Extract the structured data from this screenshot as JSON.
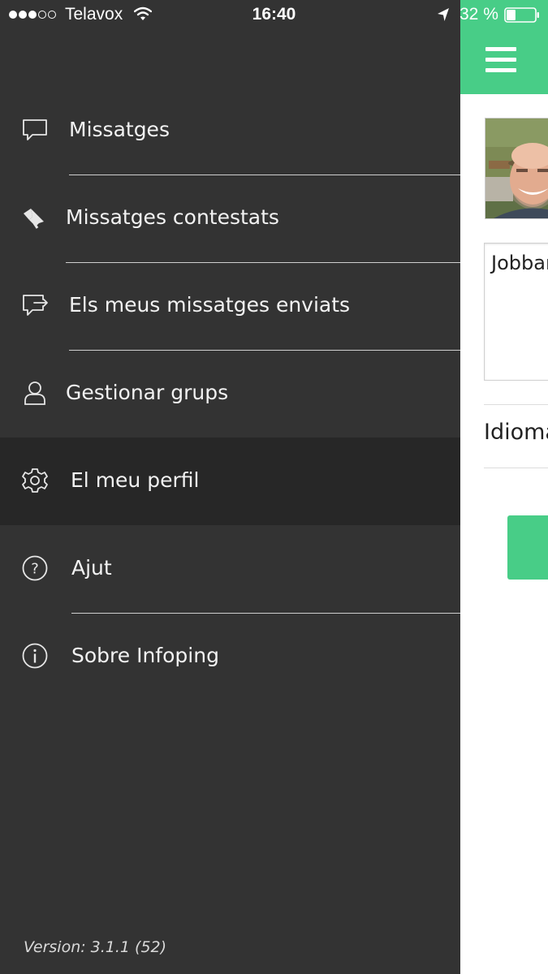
{
  "status_bar": {
    "signal_bars_filled": 3,
    "signal_bars_total": 5,
    "carrier": "Telavox",
    "time": "16:40",
    "battery_percent": "32 %",
    "battery_level": 0.32
  },
  "drawer": {
    "items": [
      {
        "label": "Missatges",
        "icon": "message-icon",
        "active": false
      },
      {
        "label": "Missatges contestats",
        "icon": "pin-icon",
        "active": false
      },
      {
        "label": "Els meus missatges enviats",
        "icon": "sent-message-icon",
        "active": false
      },
      {
        "label": "Gestionar grups",
        "icon": "user-icon",
        "active": false
      },
      {
        "label": "El meu perfil",
        "icon": "gear-icon",
        "active": true
      },
      {
        "label": "Ajut",
        "icon": "help-icon",
        "active": false
      },
      {
        "label": "Sobre Infoping",
        "icon": "info-icon",
        "active": false
      }
    ],
    "version": "Version: 3.1.1 (52)"
  },
  "profile": {
    "name_value": "Jobbar",
    "language_label": "Idioma"
  },
  "colors": {
    "accent": "#48cd87",
    "drawer_bg": "#333333",
    "drawer_active_bg": "#272727"
  }
}
